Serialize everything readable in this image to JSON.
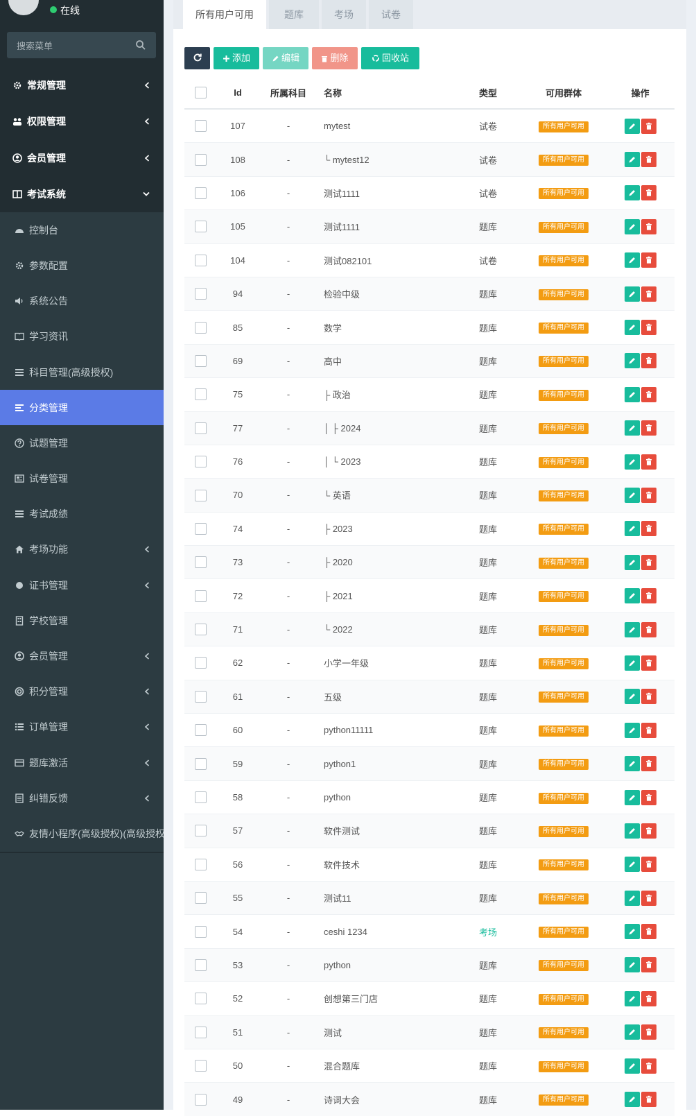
{
  "user": {
    "status": "在线"
  },
  "search": {
    "placeholder": "搜索菜单"
  },
  "menu": [
    {
      "label": "常规管理",
      "icon": "cogs-icon",
      "level": "top",
      "chevron": "left"
    },
    {
      "label": "权限管理",
      "icon": "group-icon",
      "level": "top",
      "chevron": "left"
    },
    {
      "label": "会员管理",
      "icon": "user-circle-icon",
      "level": "top",
      "chevron": "left"
    },
    {
      "label": "考试系统",
      "icon": "columns-icon",
      "level": "top",
      "chevron": "down"
    },
    {
      "label": "控制台",
      "icon": "dashboard-icon",
      "level": "sub"
    },
    {
      "label": "参数配置",
      "icon": "cogs-icon",
      "level": "sub"
    },
    {
      "label": "系统公告",
      "icon": "volume-icon",
      "level": "sub"
    },
    {
      "label": "学习资讯",
      "icon": "book-icon",
      "level": "sub"
    },
    {
      "label": "科目管理(高级授权)",
      "icon": "list-icon",
      "level": "sub"
    },
    {
      "label": "分类管理",
      "icon": "align-left-icon",
      "level": "sub",
      "active": true
    },
    {
      "label": "试题管理",
      "icon": "question-icon",
      "level": "sub"
    },
    {
      "label": "试卷管理",
      "icon": "newspaper-icon",
      "level": "sub"
    },
    {
      "label": "考试成绩",
      "icon": "list-icon",
      "level": "sub"
    },
    {
      "label": "考场功能",
      "icon": "home-icon",
      "level": "sub",
      "chevron": "left"
    },
    {
      "label": "证书管理",
      "icon": "circle-icon",
      "level": "sub",
      "chevron": "left"
    },
    {
      "label": "学校管理",
      "icon": "building-icon",
      "level": "sub"
    },
    {
      "label": "会员管理",
      "icon": "user-circle-icon",
      "level": "sub",
      "chevron": "left"
    },
    {
      "label": "积分管理",
      "icon": "life-ring-icon",
      "level": "sub",
      "chevron": "left"
    },
    {
      "label": "订单管理",
      "icon": "list-ul-icon",
      "level": "sub",
      "chevron": "left"
    },
    {
      "label": "题库激活",
      "icon": "credit-card-icon",
      "level": "sub",
      "chevron": "left"
    },
    {
      "label": "纠错反馈",
      "icon": "file-text-icon",
      "level": "sub",
      "chevron": "left"
    },
    {
      "label": "友情小程序(高级授权)(高级授权)",
      "icon": "handshake-icon",
      "level": "sub"
    }
  ],
  "tabs": [
    "所有用户可用",
    "题库",
    "考场",
    "试卷"
  ],
  "toolbar": {
    "add": "添加",
    "edit": "编辑",
    "delete": "删除",
    "recycle": "回收站"
  },
  "table": {
    "headers": {
      "id": "Id",
      "subject": "所属科目",
      "name": "名称",
      "type": "类型",
      "group": "可用群体",
      "ops": "操作"
    },
    "rows": [
      {
        "id": "107",
        "subject": "-",
        "name": "mytest",
        "type": "试卷",
        "group": "所有用户可用"
      },
      {
        "id": "108",
        "subject": "-",
        "name": "└ mytest12",
        "type": "试卷",
        "group": "所有用户可用"
      },
      {
        "id": "106",
        "subject": "-",
        "name": "测试1111",
        "type": "试卷",
        "group": "所有用户可用"
      },
      {
        "id": "105",
        "subject": "-",
        "name": "测试1111",
        "type": "题库",
        "group": "所有用户可用"
      },
      {
        "id": "104",
        "subject": "-",
        "name": "测试082101",
        "type": "试卷",
        "group": "所有用户可用"
      },
      {
        "id": "94",
        "subject": "-",
        "name": "检验中级",
        "type": "题库",
        "group": "所有用户可用"
      },
      {
        "id": "85",
        "subject": "-",
        "name": "数学",
        "type": "题库",
        "group": "所有用户可用"
      },
      {
        "id": "69",
        "subject": "-",
        "name": "高中",
        "type": "题库",
        "group": "所有用户可用"
      },
      {
        "id": "75",
        "subject": "-",
        "name": "├ 政治",
        "type": "题库",
        "group": "所有用户可用"
      },
      {
        "id": "77",
        "subject": "-",
        "name": "│ ├ 2024",
        "type": "题库",
        "group": "所有用户可用"
      },
      {
        "id": "76",
        "subject": "-",
        "name": "│ └ 2023",
        "type": "题库",
        "group": "所有用户可用"
      },
      {
        "id": "70",
        "subject": "-",
        "name": "└ 英语",
        "type": "题库",
        "group": "所有用户可用"
      },
      {
        "id": "74",
        "subject": "-",
        "name": "├ 2023",
        "type": "题库",
        "group": "所有用户可用"
      },
      {
        "id": "73",
        "subject": "-",
        "name": "├ 2020",
        "type": "题库",
        "group": "所有用户可用"
      },
      {
        "id": "72",
        "subject": "-",
        "name": "├ 2021",
        "type": "题库",
        "group": "所有用户可用"
      },
      {
        "id": "71",
        "subject": "-",
        "name": "└ 2022",
        "type": "题库",
        "group": "所有用户可用"
      },
      {
        "id": "62",
        "subject": "-",
        "name": "小学一年级",
        "type": "题库",
        "group": "所有用户可用"
      },
      {
        "id": "61",
        "subject": "-",
        "name": "五级",
        "type": "题库",
        "group": "所有用户可用"
      },
      {
        "id": "60",
        "subject": "-",
        "name": "python11111",
        "type": "题库",
        "group": "所有用户可用"
      },
      {
        "id": "59",
        "subject": "-",
        "name": "python1",
        "type": "题库",
        "group": "所有用户可用"
      },
      {
        "id": "58",
        "subject": "-",
        "name": "python",
        "type": "题库",
        "group": "所有用户可用"
      },
      {
        "id": "57",
        "subject": "-",
        "name": "软件测试",
        "type": "题库",
        "group": "所有用户可用"
      },
      {
        "id": "56",
        "subject": "-",
        "name": "软件技术",
        "type": "题库",
        "group": "所有用户可用"
      },
      {
        "id": "55",
        "subject": "-",
        "name": "测试11",
        "type": "题库",
        "group": "所有用户可用"
      },
      {
        "id": "54",
        "subject": "-",
        "name": "ceshi 1234",
        "type": "考场",
        "group": "所有用户可用"
      },
      {
        "id": "53",
        "subject": "-",
        "name": "python",
        "type": "题库",
        "group": "所有用户可用"
      },
      {
        "id": "52",
        "subject": "-",
        "name": "创想第三门店",
        "type": "题库",
        "group": "所有用户可用"
      },
      {
        "id": "51",
        "subject": "-",
        "name": "测试",
        "type": "题库",
        "group": "所有用户可用"
      },
      {
        "id": "50",
        "subject": "-",
        "name": "混合题库",
        "type": "题库",
        "group": "所有用户可用"
      },
      {
        "id": "49",
        "subject": "-",
        "name": "诗词大会",
        "type": "题库",
        "group": "所有用户可用"
      }
    ]
  },
  "colors": {
    "sidebar_bg": "#222d32",
    "active": "#5b7be6",
    "success": "#18bc9c",
    "danger": "#e74c3c",
    "warning": "#f39c12",
    "dark_btn": "#2c3e50"
  }
}
